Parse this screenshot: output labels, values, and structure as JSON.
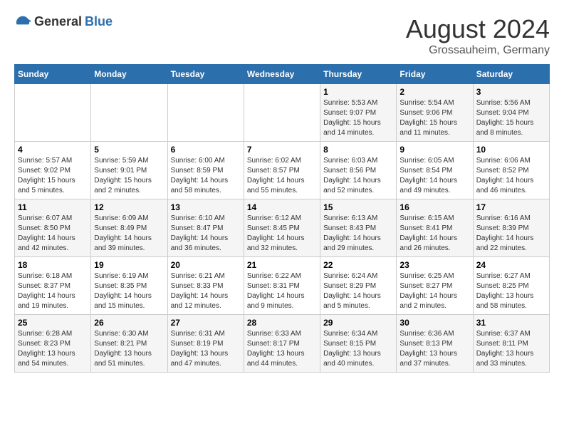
{
  "logo": {
    "general": "General",
    "blue": "Blue"
  },
  "header": {
    "month_year": "August 2024",
    "location": "Grossauheim, Germany"
  },
  "weekdays": [
    "Sunday",
    "Monday",
    "Tuesday",
    "Wednesday",
    "Thursday",
    "Friday",
    "Saturday"
  ],
  "weeks": [
    [
      {
        "day": "",
        "sunrise": "",
        "sunset": "",
        "daylight": ""
      },
      {
        "day": "",
        "sunrise": "",
        "sunset": "",
        "daylight": ""
      },
      {
        "day": "",
        "sunrise": "",
        "sunset": "",
        "daylight": ""
      },
      {
        "day": "",
        "sunrise": "",
        "sunset": "",
        "daylight": ""
      },
      {
        "day": "1",
        "sunrise": "Sunrise: 5:53 AM",
        "sunset": "Sunset: 9:07 PM",
        "daylight": "Daylight: 15 hours and 14 minutes."
      },
      {
        "day": "2",
        "sunrise": "Sunrise: 5:54 AM",
        "sunset": "Sunset: 9:06 PM",
        "daylight": "Daylight: 15 hours and 11 minutes."
      },
      {
        "day": "3",
        "sunrise": "Sunrise: 5:56 AM",
        "sunset": "Sunset: 9:04 PM",
        "daylight": "Daylight: 15 hours and 8 minutes."
      }
    ],
    [
      {
        "day": "4",
        "sunrise": "Sunrise: 5:57 AM",
        "sunset": "Sunset: 9:02 PM",
        "daylight": "Daylight: 15 hours and 5 minutes."
      },
      {
        "day": "5",
        "sunrise": "Sunrise: 5:59 AM",
        "sunset": "Sunset: 9:01 PM",
        "daylight": "Daylight: 15 hours and 2 minutes."
      },
      {
        "day": "6",
        "sunrise": "Sunrise: 6:00 AM",
        "sunset": "Sunset: 8:59 PM",
        "daylight": "Daylight: 14 hours and 58 minutes."
      },
      {
        "day": "7",
        "sunrise": "Sunrise: 6:02 AM",
        "sunset": "Sunset: 8:57 PM",
        "daylight": "Daylight: 14 hours and 55 minutes."
      },
      {
        "day": "8",
        "sunrise": "Sunrise: 6:03 AM",
        "sunset": "Sunset: 8:56 PM",
        "daylight": "Daylight: 14 hours and 52 minutes."
      },
      {
        "day": "9",
        "sunrise": "Sunrise: 6:05 AM",
        "sunset": "Sunset: 8:54 PM",
        "daylight": "Daylight: 14 hours and 49 minutes."
      },
      {
        "day": "10",
        "sunrise": "Sunrise: 6:06 AM",
        "sunset": "Sunset: 8:52 PM",
        "daylight": "Daylight: 14 hours and 46 minutes."
      }
    ],
    [
      {
        "day": "11",
        "sunrise": "Sunrise: 6:07 AM",
        "sunset": "Sunset: 8:50 PM",
        "daylight": "Daylight: 14 hours and 42 minutes."
      },
      {
        "day": "12",
        "sunrise": "Sunrise: 6:09 AM",
        "sunset": "Sunset: 8:49 PM",
        "daylight": "Daylight: 14 hours and 39 minutes."
      },
      {
        "day": "13",
        "sunrise": "Sunrise: 6:10 AM",
        "sunset": "Sunset: 8:47 PM",
        "daylight": "Daylight: 14 hours and 36 minutes."
      },
      {
        "day": "14",
        "sunrise": "Sunrise: 6:12 AM",
        "sunset": "Sunset: 8:45 PM",
        "daylight": "Daylight: 14 hours and 32 minutes."
      },
      {
        "day": "15",
        "sunrise": "Sunrise: 6:13 AM",
        "sunset": "Sunset: 8:43 PM",
        "daylight": "Daylight: 14 hours and 29 minutes."
      },
      {
        "day": "16",
        "sunrise": "Sunrise: 6:15 AM",
        "sunset": "Sunset: 8:41 PM",
        "daylight": "Daylight: 14 hours and 26 minutes."
      },
      {
        "day": "17",
        "sunrise": "Sunrise: 6:16 AM",
        "sunset": "Sunset: 8:39 PM",
        "daylight": "Daylight: 14 hours and 22 minutes."
      }
    ],
    [
      {
        "day": "18",
        "sunrise": "Sunrise: 6:18 AM",
        "sunset": "Sunset: 8:37 PM",
        "daylight": "Daylight: 14 hours and 19 minutes."
      },
      {
        "day": "19",
        "sunrise": "Sunrise: 6:19 AM",
        "sunset": "Sunset: 8:35 PM",
        "daylight": "Daylight: 14 hours and 15 minutes."
      },
      {
        "day": "20",
        "sunrise": "Sunrise: 6:21 AM",
        "sunset": "Sunset: 8:33 PM",
        "daylight": "Daylight: 14 hours and 12 minutes."
      },
      {
        "day": "21",
        "sunrise": "Sunrise: 6:22 AM",
        "sunset": "Sunset: 8:31 PM",
        "daylight": "Daylight: 14 hours and 9 minutes."
      },
      {
        "day": "22",
        "sunrise": "Sunrise: 6:24 AM",
        "sunset": "Sunset: 8:29 PM",
        "daylight": "Daylight: 14 hours and 5 minutes."
      },
      {
        "day": "23",
        "sunrise": "Sunrise: 6:25 AM",
        "sunset": "Sunset: 8:27 PM",
        "daylight": "Daylight: 14 hours and 2 minutes."
      },
      {
        "day": "24",
        "sunrise": "Sunrise: 6:27 AM",
        "sunset": "Sunset: 8:25 PM",
        "daylight": "Daylight: 13 hours and 58 minutes."
      }
    ],
    [
      {
        "day": "25",
        "sunrise": "Sunrise: 6:28 AM",
        "sunset": "Sunset: 8:23 PM",
        "daylight": "Daylight: 13 hours and 54 minutes."
      },
      {
        "day": "26",
        "sunrise": "Sunrise: 6:30 AM",
        "sunset": "Sunset: 8:21 PM",
        "daylight": "Daylight: 13 hours and 51 minutes."
      },
      {
        "day": "27",
        "sunrise": "Sunrise: 6:31 AM",
        "sunset": "Sunset: 8:19 PM",
        "daylight": "Daylight: 13 hours and 47 minutes."
      },
      {
        "day": "28",
        "sunrise": "Sunrise: 6:33 AM",
        "sunset": "Sunset: 8:17 PM",
        "daylight": "Daylight: 13 hours and 44 minutes."
      },
      {
        "day": "29",
        "sunrise": "Sunrise: 6:34 AM",
        "sunset": "Sunset: 8:15 PM",
        "daylight": "Daylight: 13 hours and 40 minutes."
      },
      {
        "day": "30",
        "sunrise": "Sunrise: 6:36 AM",
        "sunset": "Sunset: 8:13 PM",
        "daylight": "Daylight: 13 hours and 37 minutes."
      },
      {
        "day": "31",
        "sunrise": "Sunrise: 6:37 AM",
        "sunset": "Sunset: 8:11 PM",
        "daylight": "Daylight: 13 hours and 33 minutes."
      }
    ]
  ]
}
